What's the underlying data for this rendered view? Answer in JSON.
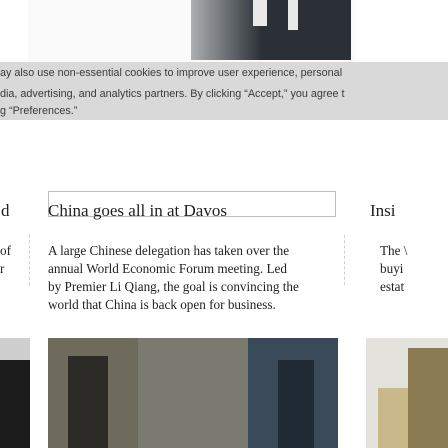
{
  "hero": {
    "caption": ""
  },
  "cookie_banner": {
    "lines": [
      "ay also use non-essential cookies to improve user experience, personal",
      "dia, advertising, and analytics partners. By clicking “Accept,” you agree t",
      "g “Preferences.”"
    ]
  },
  "columns": [
    {
      "title": "d",
      "lines": [
        "of",
        "r"
      ]
    },
    {
      "title": "China goes all in at Davos",
      "lines": [
        "A large Chinese delegation has taken over the",
        "annual World Economic Forum meeting. Led",
        "by Premier Li Qiang, the goal is convincing the",
        "world that China is back open for business."
      ]
    },
    {
      "title": "Insi",
      "lines": [
        "The \\",
        "buyi",
        "estat"
      ]
    }
  ]
}
